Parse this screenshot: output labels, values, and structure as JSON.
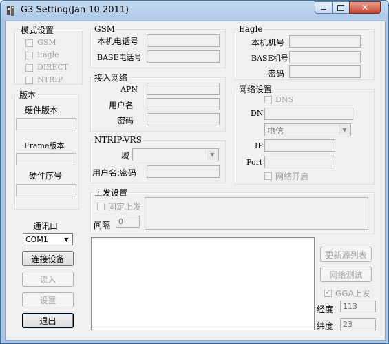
{
  "window": {
    "title": "G3 Setting(Jan 10 2011)",
    "icon": "app-icon",
    "controls": [
      "minimize-icon",
      "maximize-icon",
      "close-icon"
    ]
  },
  "mode_group": {
    "legend": "模式设置",
    "options": [
      {
        "label": "GSM",
        "checked": false
      },
      {
        "label": "Eagle",
        "checked": false
      },
      {
        "label": "DIRECT",
        "checked": false
      },
      {
        "label": "NTRIP",
        "checked": false
      }
    ]
  },
  "version_group": {
    "legend": "版本",
    "hw_version_label": "硬件版本",
    "hw_version_value": "",
    "frame_version_label": "Frame版本",
    "frame_version_value": "",
    "hw_serial_label": "硬件序号",
    "hw_serial_value": ""
  },
  "comm": {
    "port_label": "通讯口",
    "port_value": "COM1",
    "connect_label": "连接设备",
    "read_label": "读入",
    "set_label": "设置",
    "exit_label": "退出"
  },
  "gsm_group": {
    "legend": "GSM",
    "local_number_label": "本机电话号",
    "local_number_value": "",
    "base_number_label": "BASE电话号",
    "base_number_value": ""
  },
  "network_access_group": {
    "legend": "接入网络",
    "apn_label": "APN",
    "apn_value": "",
    "username_label": "用户名",
    "username_value": "",
    "password_label": "密码",
    "password_value": ""
  },
  "ntrip_group": {
    "legend": "NTRIP-VRS",
    "domain_label": "域",
    "domain_value": "",
    "userpass_label": "用户名:密码",
    "userpass_value": ""
  },
  "eagle_group": {
    "legend": "Eagle",
    "local_id_label": "本机机号",
    "local_id_value": "",
    "base_id_label": "BASE机号",
    "base_id_value": "",
    "password_label": "密码",
    "password_value": ""
  },
  "net_settings_group": {
    "legend": "网络设置",
    "dns_checkbox_label": "DNS",
    "dns_checked": false,
    "dns_field_label": "DNS",
    "dns_value": "",
    "carrier_value": "电信",
    "ip_label": "IP",
    "ip_value": "",
    "port_label": "Port",
    "port_value": "",
    "net_open_label": "网络开启",
    "net_open_checked": false
  },
  "upload_group": {
    "legend": "上发设置",
    "fixed_upload_label": "固定上发",
    "fixed_upload_checked": false,
    "interval_label": "间隔",
    "interval_value": "0"
  },
  "right_controls": {
    "update_source_label": "更新源列表",
    "net_test_label": "网络测试",
    "gga_upload_label": "GGA上发",
    "gga_checked": true,
    "longitude_label": "经度",
    "longitude_value": "113",
    "latitude_label": "纬度",
    "latitude_value": "23"
  }
}
